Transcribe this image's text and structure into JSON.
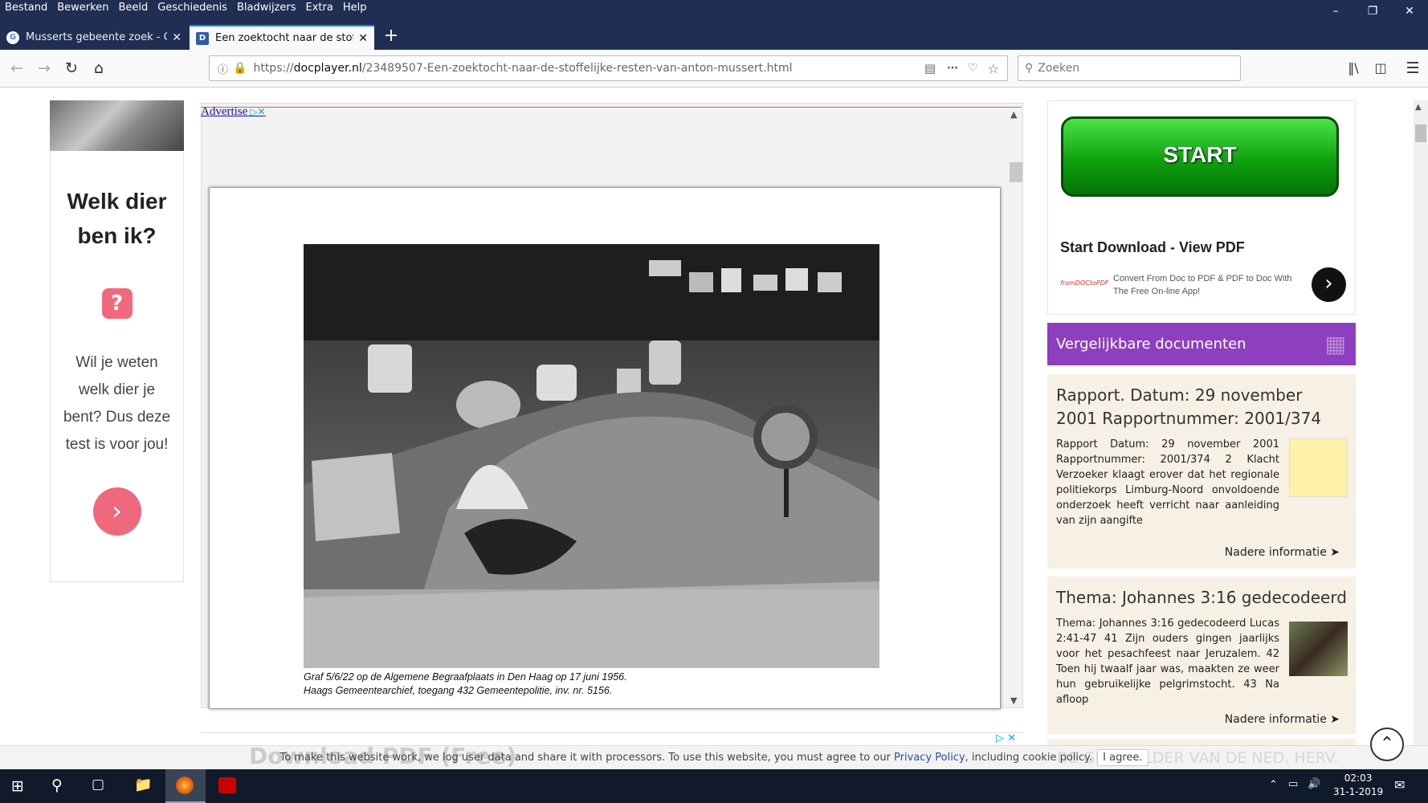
{
  "menu": [
    "Bestand",
    "Bewerken",
    "Beeld",
    "Geschiedenis",
    "Bladwijzers",
    "Extra",
    "Help"
  ],
  "tabs": [
    {
      "title": "Musserts gebeente zoek - Goo"
    },
    {
      "title": "Een zoektocht naar de stoffelijk"
    }
  ],
  "url": {
    "prefix": "https://",
    "domain": "docplayer.nl",
    "path": "/23489507-Een-zoektocht-naar-de-stoffelijke-resten-van-anton-mussert.html"
  },
  "search": {
    "placeholder": "Zoeken"
  },
  "left_ad": {
    "title": "Welk dier ben ik?",
    "body": "Wil je weten welk dier je bent? Dus deze test is voor jou!"
  },
  "viewer": {
    "advertise": "Advertise"
  },
  "doc": {
    "caption_line1": "Graf 5/6/22 op de Algemene Begraafplaats in Den Haag op 17 juni 1956.",
    "caption_line2": "Haags Gemeentearchief, toegang 432 Gemeentepolitie, inv. nr. 5156."
  },
  "right_ad": {
    "button": "START",
    "title": "Start Download - View PDF",
    "text": "Convert From Doc to PDF & PDF to Doc With The Free On-line App!",
    "brand": "fromDOCtoPDF"
  },
  "similar": {
    "header": "Vergelijkbare documenten",
    "items": [
      {
        "title": "Rapport. Datum: 29 november 2001 Rapportnummer: 2001/374",
        "text": "Rapport Datum: 29 november 2001 Rapportnummer: 2001/374 2 Klacht Verzoeker klaagt erover dat het regionale politiekorps Limburg-Noord onvoldoende onderzoek heeft verricht naar aanleiding van zijn aangifte",
        "more": "Nadere informatie"
      },
      {
        "title": "Thema: Johannes 3:16 gedecodeerd",
        "text": "Thema: Johannes 3:16 gedecodeerd Lucas 2:41-47 41 Zijn ouders gingen jaarlijks voor het pesachfeest naar Jeruzalem. 42 Toen hij twaalf jaar was, maakten ze weer hun gebruikelijke pelgrimstocht. 43 Na afloop",
        "more": "Nadere informatie"
      }
    ],
    "partial": "DE GRAFKELDER VAN DE NED. HERV."
  },
  "download_bg": "Download PDF (Free)",
  "cookie": {
    "text": "To make this website work, we log user data and share it with processors. To use this website, you must agree to our ",
    "link": "Privacy Policy",
    "text2": ", including cookie policy.",
    "button": "I agree."
  },
  "clock": {
    "time": "02:03",
    "date": "31-1-2019"
  }
}
